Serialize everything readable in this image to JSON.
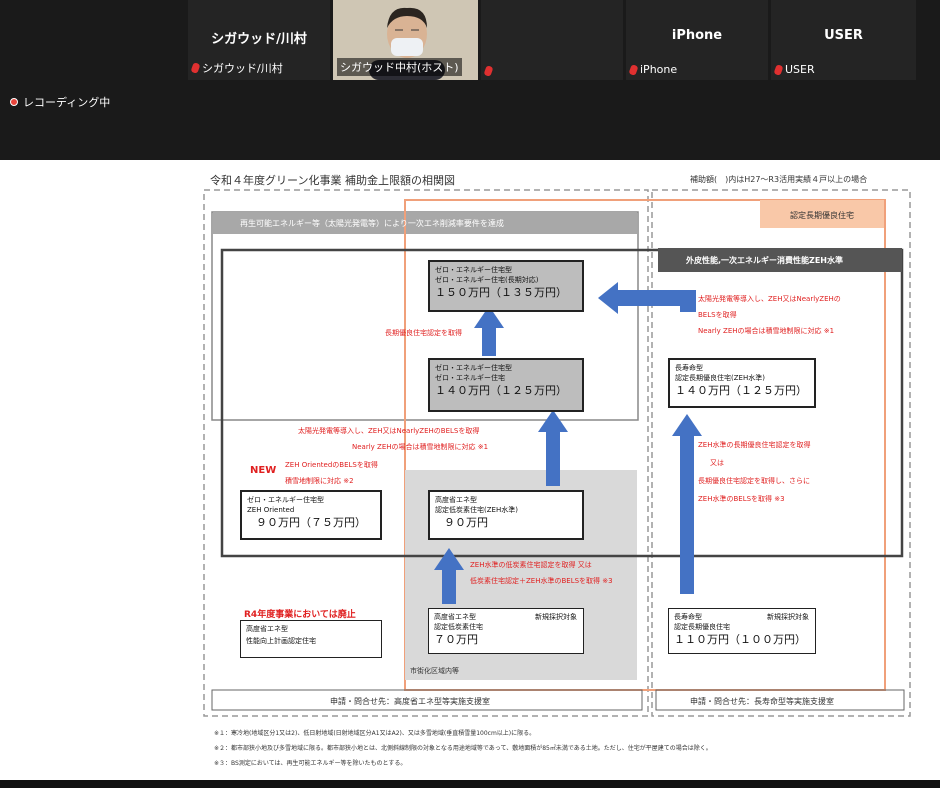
{
  "meeting": {
    "participants": [
      {
        "name": "シガウッド/川村",
        "label": "シガウッド/川村"
      },
      {
        "name": "",
        "label": "シガウッド中村(ホスト)"
      },
      {
        "name": "",
        "label": ""
      },
      {
        "name": "iPhone",
        "label": "iPhone"
      },
      {
        "name": "USER",
        "label": "USER"
      }
    ],
    "recording": "レコーディング中"
  },
  "slide": {
    "title": "令和４年度グリーン化事業 補助金上限額の相関図",
    "header_note": "補助額(　)内はH27～R3活用実績４戸以上の場合",
    "renewable_header": "再生可能エネルギー等（太陽光発電等）により一次エネ削減率要件を達成",
    "longlife_header": "認定長期優良住宅",
    "zeh_header": "外皮性能,一次エネルギー消費性能ZEH水準",
    "zero_energy_top": {
      "l1": "ゼロ・エネルギー住宅型",
      "l2": "ゼロ・エネルギー住宅(長期対応)",
      "amount": "１５０万円（１３５万円）"
    },
    "zero_energy_mid": {
      "l1": "ゼロ・エネルギー住宅型",
      "l2": "ゼロ・エネルギー住宅",
      "amount": "１４０万円（１２５万円）"
    },
    "zeh_oriented": {
      "l1": "ゼロ・エネルギー住宅型",
      "l2": "ZEH Oriented",
      "amount": "９０万円（７５万円）"
    },
    "high_eff_zeh": {
      "l1": "高度省エネ型",
      "l2": "認定低炭素住宅(ZEH水準)",
      "amount": "９０万円"
    },
    "high_eff_low": {
      "l1": "高度省エネ型",
      "l2": "認定低炭素住宅",
      "amount": "７０万円",
      "tag": "新規採択対象"
    },
    "abolished": {
      "l1": "高度省エネ型",
      "l2": "性能向上計画認定住宅"
    },
    "longlife_zeh": {
      "l1": "長寿命型",
      "l2": "認定長期優良住宅(ZEH水準)",
      "amount": "１４０万円（１２５万円）"
    },
    "longlife_low": {
      "l1": "長寿命型",
      "l2": "認定長期優良住宅",
      "amount": "１１０万円（１００万円）",
      "tag": "新規採択対象"
    },
    "notes": {
      "longlife_cert": "長期優良住宅認定を取得",
      "right_top_1": "太陽光発電等導入し、ZEH又はNearlyZEHの",
      "right_top_2": "BELSを取得",
      "right_top_3": "Nearly ZEHの場合は積雪地制限に対応 ※1",
      "mid_1": "太陽光発電等導入し、ZEH又はNearlyZEHのBELSを取得",
      "mid_2": "Nearly ZEHの場合は積雪地制限に対応 ※1",
      "new_badge": "NEW",
      "oriented_1": "ZEH OrientedのBELSを取得",
      "oriented_2": "積雪地制限に対応 ※2",
      "right_mid_1": "ZEH水準の長期優良住宅認定を取得",
      "right_mid_2": "又は",
      "right_mid_3": "長期優良住宅認定を取得し、さらに",
      "right_mid_4": "ZEH水準のBELSを取得 ※3",
      "low_1": "ZEH水準の低炭素住宅認定を取得 又は",
      "low_2": "低炭素住宅認定＋ZEH水準のBELSを取得 ※3",
      "abolished_title": "R4年度事業においては廃止",
      "urban": "市街化区域内等"
    },
    "contact_left": "申請・問合せ先：高度省エネ型等実施支援室",
    "contact_right": "申請・問合せ先：長寿命型等実施支援室",
    "footnotes": [
      "※１：寒冷地(地域区分1又は2)、低日射地域(日射地域区分A1又はA2)、又は多雪地域(垂直積雪量100cm以上)に限る。",
      "※２：都市部狭小地及び多雪地域に限る。都市部狭小地とは、北側斜線制限の対象となる用途地域等であって、敷地面積が85㎡未満である土地。ただし、住宅が平屋建ての場合は除く。",
      "※３：BS測定においては、再生可能エネルギー等を除いたものとする。"
    ]
  }
}
